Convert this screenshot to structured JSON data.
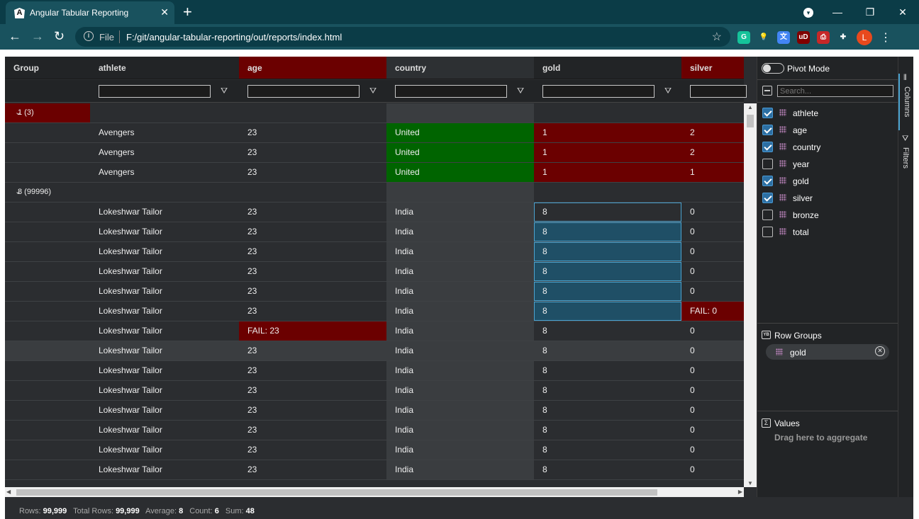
{
  "browser": {
    "tab_title": "Angular Tabular Reporting",
    "tab_favicon": "A",
    "tab_close": "✕",
    "new_tab": "+",
    "profile_badge": "▾",
    "minimize": "—",
    "maximize": "❐",
    "close": "✕",
    "back": "←",
    "forward": "→",
    "reload": "↻",
    "info_icon": "i",
    "scheme": "File",
    "url": "F:/git/angular-tabular-reporting/out/reports/index.html",
    "star": "☆",
    "extensions": [
      {
        "name": "grammarly-icon",
        "glyph": "G",
        "color": "#15c39a"
      },
      {
        "name": "lightbulb-icon",
        "glyph": "💡",
        "color": "#19525e"
      },
      {
        "name": "translate-icon",
        "glyph": "文",
        "color": "#4285f4"
      },
      {
        "name": "ublock-icon",
        "glyph": "uD",
        "color": "#800000"
      },
      {
        "name": "printer-icon",
        "glyph": "⎙",
        "color": "#c62828"
      },
      {
        "name": "puzzle-icon",
        "glyph": "✚",
        "color": "#19525e"
      }
    ],
    "avatar": "L",
    "menu": "⋮"
  },
  "grid": {
    "columns": [
      {
        "key": "group",
        "label": "Group",
        "header_bg": "#222426"
      },
      {
        "key": "athlete",
        "label": "athlete",
        "header_bg": "#222426"
      },
      {
        "key": "age",
        "label": "age",
        "header_bg": "#6b0000"
      },
      {
        "key": "country",
        "label": "country",
        "header_bg": "#2d3033"
      },
      {
        "key": "gold",
        "label": "gold",
        "header_bg": "#222426"
      },
      {
        "key": "silver",
        "label": "silver",
        "header_bg": "#6b0000"
      }
    ],
    "filter_icon": "⛛",
    "groups": [
      {
        "label": "1 (3)",
        "chevron": "⌄",
        "rows": [
          {
            "athlete": "Avengers",
            "age": "23",
            "country": "United",
            "gold": "1",
            "silver": "2"
          },
          {
            "athlete": "Avengers",
            "age": "23",
            "country": "United",
            "gold": "1",
            "silver": "2"
          },
          {
            "athlete": "Avengers",
            "age": "23",
            "country": "United",
            "gold": "1",
            "silver": "1"
          }
        ]
      },
      {
        "label": "8 (99996)",
        "chevron": "⌄",
        "rows": [
          {
            "athlete": "Lokeshwar Tailor",
            "age": "23",
            "country": "India",
            "gold": "8",
            "silver": "0"
          },
          {
            "athlete": "Lokeshwar Tailor",
            "age": "23",
            "country": "India",
            "gold": "8",
            "silver": "0"
          },
          {
            "athlete": "Lokeshwar Tailor",
            "age": "23",
            "country": "India",
            "gold": "8",
            "silver": "0"
          },
          {
            "athlete": "Lokeshwar Tailor",
            "age": "23",
            "country": "India",
            "gold": "8",
            "silver": "0"
          },
          {
            "athlete": "Lokeshwar Tailor",
            "age": "23",
            "country": "India",
            "gold": "8",
            "silver": "0"
          },
          {
            "athlete": "Lokeshwar Tailor",
            "age": "23",
            "country": "India",
            "gold": "8",
            "silver": "FAIL: 0"
          },
          {
            "athlete": "Lokeshwar Tailor",
            "age": "FAIL: 23",
            "country": "India",
            "gold": "8",
            "silver": "0"
          },
          {
            "athlete": "Lokeshwar Tailor",
            "age": "23",
            "country": "India",
            "gold": "8",
            "silver": "0"
          },
          {
            "athlete": "Lokeshwar Tailor",
            "age": "23",
            "country": "India",
            "gold": "8",
            "silver": "0"
          },
          {
            "athlete": "Lokeshwar Tailor",
            "age": "23",
            "country": "India",
            "gold": "8",
            "silver": "0"
          },
          {
            "athlete": "Lokeshwar Tailor",
            "age": "23",
            "country": "India",
            "gold": "8",
            "silver": "0"
          },
          {
            "athlete": "Lokeshwar Tailor",
            "age": "23",
            "country": "India",
            "gold": "8",
            "silver": "0"
          },
          {
            "athlete": "Lokeshwar Tailor",
            "age": "23",
            "country": "India",
            "gold": "8",
            "silver": "0"
          },
          {
            "athlete": "Lokeshwar Tailor",
            "age": "23",
            "country": "India",
            "gold": "8",
            "silver": "0"
          }
        ]
      }
    ],
    "colors": {
      "fail_red": "#6b0000",
      "pass_green": "#006400",
      "selection_blue": "#1f4f66",
      "selection_border": "#4aa3d0",
      "country_col": "#3a3d40"
    }
  },
  "scroll": {
    "up": "▲",
    "down": "▼",
    "left": "◀",
    "right": "▶"
  },
  "status": {
    "rows_label": "Rows:",
    "rows_value": "99,999",
    "total_label": "Total Rows:",
    "total_value": "99,999",
    "avg_label": "Average:",
    "avg_value": "8",
    "count_label": "Count:",
    "count_value": "6",
    "sum_label": "Sum:",
    "sum_value": "48"
  },
  "side_panel": {
    "pivot_label": "Pivot Mode",
    "search_placeholder": "Search...",
    "columns": [
      {
        "label": "athlete",
        "checked": true
      },
      {
        "label": "age",
        "checked": true
      },
      {
        "label": "country",
        "checked": true
      },
      {
        "label": "year",
        "checked": false
      },
      {
        "label": "gold",
        "checked": true
      },
      {
        "label": "silver",
        "checked": true
      },
      {
        "label": "bronze",
        "checked": false
      },
      {
        "label": "total",
        "checked": false
      }
    ],
    "row_groups_label": "Row Groups",
    "row_group_icon": "YB",
    "row_group_pill": "gold",
    "remove_icon": "✕",
    "values_icon": "Σ",
    "values_label": "Values",
    "values_hint": "Drag here to aggregate",
    "tab_columns": "Columns",
    "tab_columns_icon": "⦀",
    "tab_filters": "Filters",
    "tab_filters_icon": "⛛"
  }
}
